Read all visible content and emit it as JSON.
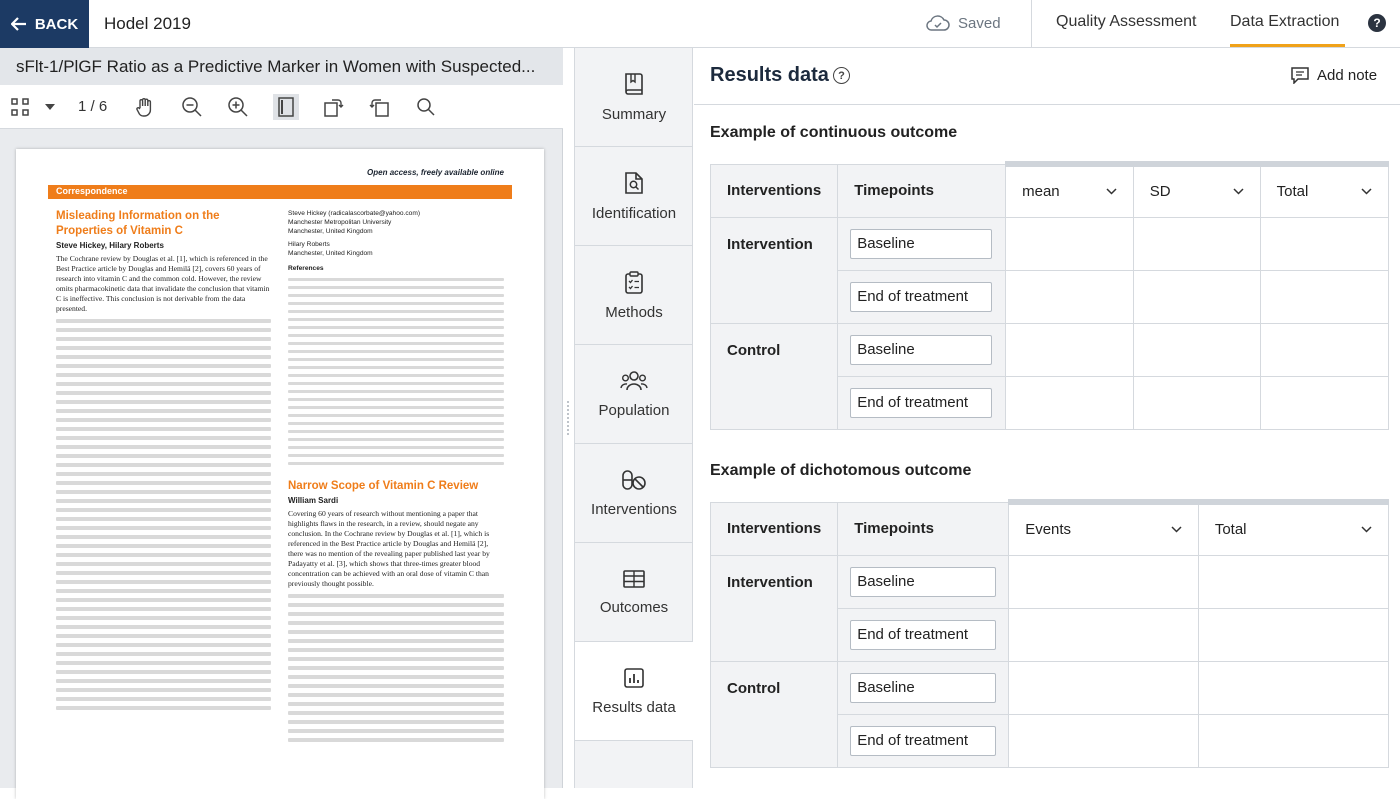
{
  "topbar": {
    "back_label": "BACK",
    "study": "Hodel 2019",
    "saved": "Saved",
    "tabs": [
      "Quality Assessment",
      "Data Extraction"
    ],
    "help": "?"
  },
  "pdf": {
    "title": "sFlt-1/PlGF Ratio as a Predictive Marker in Women with Suspected...",
    "page": "1 / 6",
    "open_access": "Open access, freely available online",
    "section": "Correspondence",
    "article1_title": "Misleading Information on the Properties of Vitamin C",
    "article1_authors": "Steve Hickey, Hilary Roberts",
    "article1_text": "The Cochrane review by Douglas et al. [1], which is referenced in the Best Practice article by Douglas and Hemilä [2], covers 60 years of research into vitamin C and the common cold. However, the review omits pharmacokinetic data that invalidate the conclusion that vitamin C is ineffective. This conclusion is not derivable from the data presented.",
    "author_block": "Steve Hickey (radicalascorbate@yahoo.com)",
    "affil1": "Manchester Metropolitan University",
    "affil2": "Manchester, United Kingdom",
    "author2": "Hilary Roberts",
    "affil3": "Manchester, United Kingdom",
    "references": "References",
    "article2_title": "Narrow Scope of Vitamin C Review",
    "article2_author": "William Sardi",
    "article2_text": "Covering 60 years of research without mentioning a paper that highlights flaws in the research, in a review, should negate any conclusion. In the Cochrane review by Douglas et al. [1], which is referenced in the Best Practice article by Douglas and Hemilä [2], there was no mention of the revealing paper published last year by Padayatty et al. [3], which shows that three-times greater blood concentration can be achieved with an oral dose of vitamin C than previously thought possible."
  },
  "nav": {
    "items": [
      {
        "label": "Summary",
        "icon": "book-icon"
      },
      {
        "label": "Identification",
        "icon": "doc-search-icon"
      },
      {
        "label": "Methods",
        "icon": "clipboard-icon"
      },
      {
        "label": "Population",
        "icon": "people-icon"
      },
      {
        "label": "Interventions",
        "icon": "pill-icon"
      },
      {
        "label": "Outcomes",
        "icon": "table-icon"
      },
      {
        "label": "Results data",
        "icon": "chart-icon"
      }
    ]
  },
  "content": {
    "title": "Results data",
    "add_note": "Add note",
    "continuous": {
      "title": "Example of continuous outcome",
      "headers": {
        "interventions": "Interventions",
        "timepoints": "Timepoints",
        "cols": [
          "mean",
          "SD",
          "Total"
        ]
      },
      "arms": [
        {
          "name": "Intervention",
          "timepoints": [
            "Baseline",
            "End of treatment"
          ]
        },
        {
          "name": "Control",
          "timepoints": [
            "Baseline",
            "End of treatment"
          ]
        }
      ]
    },
    "dichotomous": {
      "title": "Example of dichotomous outcome",
      "headers": {
        "interventions": "Interventions",
        "timepoints": "Timepoints",
        "cols": [
          "Events",
          "Total"
        ]
      },
      "arms": [
        {
          "name": "Intervention",
          "timepoints": [
            "Baseline",
            "End of treatment"
          ]
        },
        {
          "name": "Control",
          "timepoints": [
            "Baseline",
            "End of treatment"
          ]
        }
      ]
    }
  }
}
